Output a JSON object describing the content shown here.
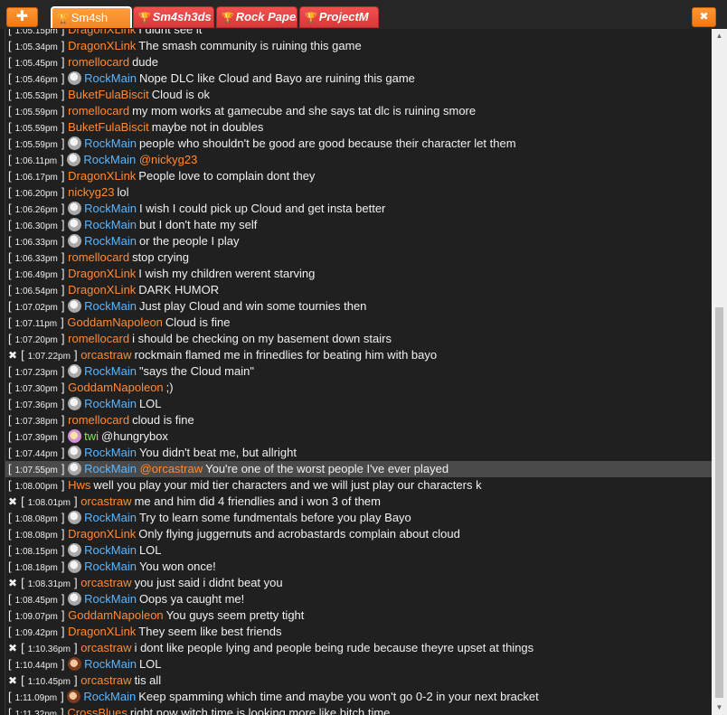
{
  "toolbar": {
    "add_label": "✚",
    "close_label": "✖"
  },
  "tabs": [
    {
      "label": "Sm4sh",
      "active": true
    },
    {
      "label": "Sm4sh3ds",
      "active": false
    },
    {
      "label": "Rock Paper S",
      "active": false
    },
    {
      "label": "ProjectM",
      "active": false
    }
  ],
  "messages": [
    {
      "x": false,
      "time": "1:05.15pm",
      "user": "DragonXLink",
      "color": "orange",
      "avatar": "",
      "mention": "",
      "text": "I didnt see it"
    },
    {
      "x": false,
      "time": "1:05.34pm",
      "user": "DragonXLink",
      "color": "orange",
      "avatar": "",
      "mention": "",
      "text": "The smash community is ruining this game"
    },
    {
      "x": false,
      "time": "1:05.45pm",
      "user": "romellocard",
      "color": "orange",
      "avatar": "",
      "mention": "",
      "text": "dude"
    },
    {
      "x": false,
      "time": "1:05.46pm",
      "user": "RockMain",
      "color": "blue",
      "avatar": "gray",
      "mention": "",
      "text": "Nope DLC like Cloud and Bayo are ruining this game"
    },
    {
      "x": false,
      "time": "1:05.53pm",
      "user": "BuketFulaBiscit",
      "color": "orange",
      "avatar": "",
      "mention": "",
      "text": "Cloud is ok"
    },
    {
      "x": false,
      "time": "1:05.59pm",
      "user": "romellocard",
      "color": "orange",
      "avatar": "",
      "mention": "",
      "text": "my mom works at gamecube and she says tat dlc is ruining smore"
    },
    {
      "x": false,
      "time": "1:05.59pm",
      "user": "BuketFulaBiscit",
      "color": "orange",
      "avatar": "",
      "mention": "",
      "text": "maybe not in doubles"
    },
    {
      "x": false,
      "time": "1:05.59pm",
      "user": "RockMain",
      "color": "blue",
      "avatar": "gray",
      "mention": "",
      "text": "people who shouldn't be good are good because their character let them"
    },
    {
      "x": false,
      "time": "1:06.11pm",
      "user": "RockMain",
      "color": "blue",
      "avatar": "gray",
      "mention": "@nickyg23",
      "text": ""
    },
    {
      "x": false,
      "time": "1:06.17pm",
      "user": "DragonXLink",
      "color": "orange",
      "avatar": "",
      "mention": "",
      "text": "People love to complain dont they"
    },
    {
      "x": false,
      "time": "1:06.20pm",
      "user": "nickyg23",
      "color": "orange",
      "avatar": "",
      "mention": "",
      "text": "lol"
    },
    {
      "x": false,
      "time": "1:06.26pm",
      "user": "RockMain",
      "color": "blue",
      "avatar": "gray",
      "mention": "",
      "text": "I wish I could pick up Cloud and get insta better"
    },
    {
      "x": false,
      "time": "1:06.30pm",
      "user": "RockMain",
      "color": "blue",
      "avatar": "gray",
      "mention": "",
      "text": "but I don't hate my self"
    },
    {
      "x": false,
      "time": "1:06.33pm",
      "user": "RockMain",
      "color": "blue",
      "avatar": "gray",
      "mention": "",
      "text": "or the people I play"
    },
    {
      "x": false,
      "time": "1:06.33pm",
      "user": "romellocard",
      "color": "orange",
      "avatar": "",
      "mention": "",
      "text": "stop crying"
    },
    {
      "x": false,
      "time": "1:06.49pm",
      "user": "DragonXLink",
      "color": "orange",
      "avatar": "",
      "mention": "",
      "text": "I wish my children werent starving"
    },
    {
      "x": false,
      "time": "1:06.54pm",
      "user": "DragonXLink",
      "color": "orange",
      "avatar": "",
      "mention": "",
      "text": "DARK HUMOR"
    },
    {
      "x": false,
      "time": "1:07.02pm",
      "user": "RockMain",
      "color": "blue",
      "avatar": "gray",
      "mention": "",
      "text": "Just play Cloud and win some tournies then"
    },
    {
      "x": false,
      "time": "1:07.11pm",
      "user": "GoddamNapoleon",
      "color": "orange",
      "avatar": "",
      "mention": "",
      "text": "Cloud is fine"
    },
    {
      "x": false,
      "time": "1:07.20pm",
      "user": "romellocard",
      "color": "orange",
      "avatar": "",
      "mention": "",
      "text": "i should be checking on my basement down stairs"
    },
    {
      "x": true,
      "time": "1:07.22pm",
      "user": "orcastraw",
      "color": "orange",
      "avatar": "",
      "mention": "",
      "text": "rockmain flamed me in frinedlies for beating him with bayo"
    },
    {
      "x": false,
      "time": "1:07.23pm",
      "user": "RockMain",
      "color": "blue",
      "avatar": "gray",
      "mention": "",
      "text": "\"says the Cloud main\""
    },
    {
      "x": false,
      "time": "1:07.30pm",
      "user": "GoddamNapoleon",
      "color": "orange",
      "avatar": "",
      "mention": "",
      "text": ";)"
    },
    {
      "x": false,
      "time": "1:07.36pm",
      "user": "RockMain",
      "color": "blue",
      "avatar": "gray",
      "mention": "",
      "text": "LOL"
    },
    {
      "x": false,
      "time": "1:07.38pm",
      "user": "romellocard",
      "color": "orange",
      "avatar": "",
      "mention": "",
      "text": "cloud is fine"
    },
    {
      "x": false,
      "time": "1:07.39pm",
      "user": "twi",
      "color": "green",
      "avatar": "twi",
      "mention": "",
      "text": "@hungrybox"
    },
    {
      "x": false,
      "time": "1:07.44pm",
      "user": "RockMain",
      "color": "blue",
      "avatar": "gray",
      "mention": "",
      "text": "You didn't beat me, but allright"
    },
    {
      "x": false,
      "time": "1:07.55pm",
      "user": "RockMain",
      "color": "blue",
      "avatar": "gray",
      "mention": "@orcastraw",
      "text": "You're one of the worst people I've ever played",
      "highlight": true
    },
    {
      "x": false,
      "time": "1:08.00pm",
      "user": "Hws",
      "color": "orange",
      "avatar": "",
      "mention": "",
      "text": "well you play your mid tier characters and we will just play our characters k"
    },
    {
      "x": true,
      "time": "1:08.01pm",
      "user": "orcastraw",
      "color": "orange",
      "avatar": "",
      "mention": "",
      "text": "me and him did 4 friendlies and i won 3 of them"
    },
    {
      "x": false,
      "time": "1:08.08pm",
      "user": "RockMain",
      "color": "blue",
      "avatar": "gray",
      "mention": "",
      "text": "Try to learn some fundmentals before you play Bayo"
    },
    {
      "x": false,
      "time": "1:08.08pm",
      "user": "DragonXLink",
      "color": "orange",
      "avatar": "",
      "mention": "",
      "text": "Only flying juggernuts and acrobastards complain about cloud"
    },
    {
      "x": false,
      "time": "1:08.15pm",
      "user": "RockMain",
      "color": "blue",
      "avatar": "gray",
      "mention": "",
      "text": "LOL"
    },
    {
      "x": false,
      "time": "1:08.18pm",
      "user": "RockMain",
      "color": "blue",
      "avatar": "gray",
      "mention": "",
      "text": "You won once!"
    },
    {
      "x": true,
      "time": "1:08.31pm",
      "user": "orcastraw",
      "color": "orange",
      "avatar": "",
      "mention": "",
      "text": "you just said i didnt beat you"
    },
    {
      "x": false,
      "time": "1:08.45pm",
      "user": "RockMain",
      "color": "blue",
      "avatar": "gray",
      "mention": "",
      "text": "Oops ya caught me!"
    },
    {
      "x": false,
      "time": "1:09.07pm",
      "user": "GoddamNapoleon",
      "color": "orange",
      "avatar": "",
      "mention": "",
      "text": "You guys seem pretty tight"
    },
    {
      "x": false,
      "time": "1:09.42pm",
      "user": "DragonXLink",
      "color": "orange",
      "avatar": "",
      "mention": "",
      "text": "They seem like best friends"
    },
    {
      "x": true,
      "time": "1:10.36pm",
      "user": "orcastraw",
      "color": "orange",
      "avatar": "",
      "mention": "",
      "text": "i dont like people lying and people being rude because theyre upset at things"
    },
    {
      "x": false,
      "time": "1:10.44pm",
      "user": "RockMain",
      "color": "blue",
      "avatar": "red",
      "mention": "",
      "text": "LOL"
    },
    {
      "x": true,
      "time": "1:10.45pm",
      "user": "orcastraw",
      "color": "orange",
      "avatar": "",
      "mention": "",
      "text": "tis all"
    },
    {
      "x": false,
      "time": "1:11.09pm",
      "user": "RockMain",
      "color": "blue",
      "avatar": "red",
      "mention": "",
      "text": "Keep spamming which time and maybe you won't go 0-2 in your next bracket"
    },
    {
      "x": false,
      "time": "1:11.32pm",
      "user": "CrossBlues",
      "color": "orange",
      "avatar": "",
      "mention": "",
      "text": "right now witch time is looking more like bitch time"
    }
  ]
}
